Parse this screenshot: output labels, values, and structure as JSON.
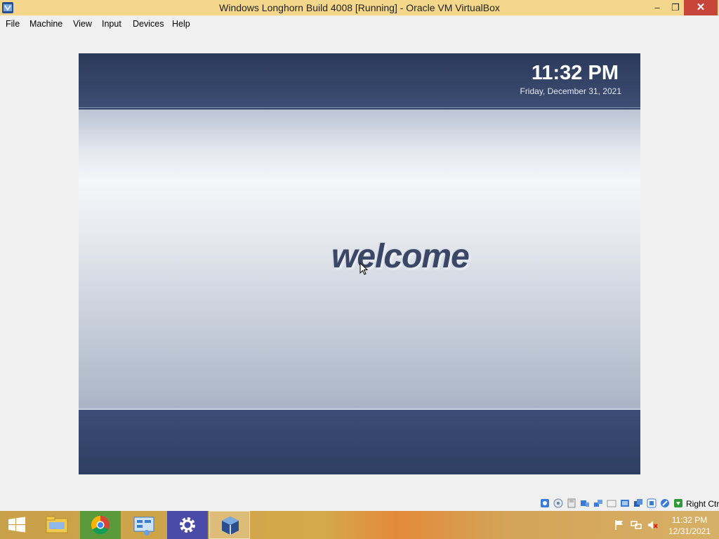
{
  "window": {
    "title": "Windows Longhorn Build 4008 [Running] - Oracle VM VirtualBox",
    "minimize_symbol": "–",
    "maximize_symbol": "❐",
    "close_symbol": "✕"
  },
  "menu": {
    "items": [
      "File",
      "Machine",
      "View",
      "Input",
      "Devices",
      "Help"
    ]
  },
  "vm": {
    "clock": "11:32 PM",
    "date": "Friday, December 31, 2021",
    "welcome": "welcome"
  },
  "statusbar": {
    "host_key": "Right Ctrl",
    "icons": [
      "hard-disk-icon",
      "optical-drive-icon",
      "floppy-icon",
      "audio-icon",
      "network-icon",
      "usb-icon",
      "shared-folders-icon",
      "display-icon",
      "video-capture-icon",
      "cpu-icon",
      "mouse-integration-icon",
      "arrow-down-icon"
    ]
  },
  "taskbar": {
    "apps": [
      "file-explorer",
      "chrome",
      "control-panel",
      "settings",
      "virtualbox"
    ],
    "active_app": "virtualbox",
    "time": "11:32 PM",
    "date": "12/31/2021",
    "tray_icons": [
      "action-center-flag-icon",
      "network-icon",
      "volume-muted-icon"
    ]
  },
  "colors": {
    "titlebar": "#f4d78a",
    "close_button": "#c7453a",
    "vm_band": "#2f3f63"
  }
}
